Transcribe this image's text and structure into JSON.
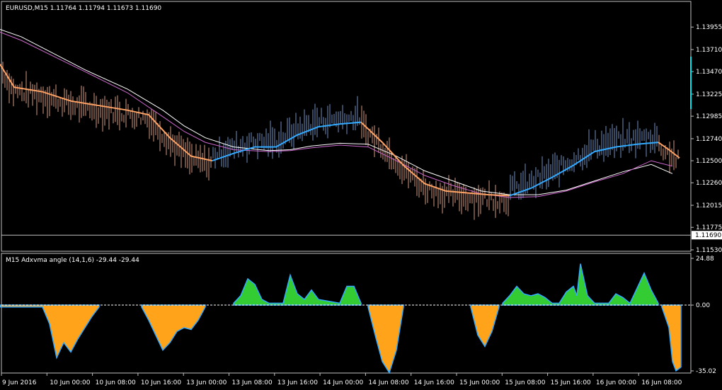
{
  "chart_data": [
    {
      "type": "line",
      "title": "EURUSD,M15  1.11764 1.11794 1.11673 1.11690",
      "ylim": [
        1.1153,
        1.1408
      ],
      "yticks": [
        "1.13955",
        "1.13710",
        "1.13470",
        "1.13225",
        "1.12985",
        "1.12740",
        "1.12500",
        "1.12260",
        "1.12015",
        "1.11775",
        "1.11530"
      ],
      "ytick_values": [
        1.13955,
        1.1371,
        1.1347,
        1.13225,
        1.12985,
        1.1274,
        1.125,
        1.1226,
        1.12015,
        1.11775,
        1.1153
      ],
      "current_price_label": "1.11690",
      "current_price": 1.1169,
      "grid": false,
      "bar_colors": {
        "up": "#6e8fc0",
        "down": "#d49a7e"
      },
      "series": [
        {
          "color": "#ffffff",
          "x": [
            0,
            30,
            80,
            120,
            180,
            230,
            260,
            290,
            330,
            380,
            410,
            440,
            480,
            520,
            560,
            600,
            640,
            680,
            720,
            760,
            800,
            840,
            880,
            920,
            950
          ],
          "y": [
            1.1393,
            1.1385,
            1.1365,
            1.1349,
            1.1328,
            1.1305,
            1.1288,
            1.1275,
            1.1265,
            1.1261,
            1.1262,
            1.1266,
            1.1269,
            1.1268,
            1.1255,
            1.1239,
            1.1228,
            1.1217,
            1.1213,
            1.1213,
            1.1218,
            1.1228,
            1.1238,
            1.1246,
            1.1236
          ]
        },
        {
          "color": "#cc66cc",
          "x": [
            0,
            30,
            80,
            120,
            180,
            230,
            260,
            290,
            330,
            380,
            410,
            440,
            480,
            520,
            560,
            600,
            640,
            680,
            720,
            760,
            800,
            840,
            880,
            920,
            950
          ],
          "y": [
            1.139,
            1.1381,
            1.1362,
            1.1347,
            1.1324,
            1.1298,
            1.1282,
            1.127,
            1.1262,
            1.126,
            1.1261,
            1.1264,
            1.1267,
            1.1265,
            1.125,
            1.1234,
            1.1223,
            1.1214,
            1.121,
            1.1211,
            1.1217,
            1.1227,
            1.1236,
            1.125,
            1.1244
          ]
        },
        {
          "color": "#ffa366",
          "x": [
            0,
            20,
            60,
            100,
            140,
            180,
            210,
            240,
            270,
            300
          ],
          "y": [
            1.1355,
            1.133,
            1.1325,
            1.1315,
            1.131,
            1.1305,
            1.13,
            1.1275,
            1.1255,
            1.125
          ]
        },
        {
          "color": "#33aaff",
          "x": [
            300,
            330,
            360,
            390,
            420,
            450,
            480,
            510
          ],
          "y": [
            1.125,
            1.1258,
            1.1265,
            1.1265,
            1.1278,
            1.1287,
            1.129,
            1.1292
          ]
        },
        {
          "color": "#ffa366",
          "x": [
            510,
            540,
            570,
            600,
            630,
            660,
            690,
            720
          ],
          "y": [
            1.1292,
            1.127,
            1.1245,
            1.1225,
            1.1217,
            1.1215,
            1.1213,
            1.1212
          ]
        },
        {
          "color": "#33aaff",
          "x": [
            720,
            750,
            780,
            810,
            840,
            870,
            900,
            930
          ],
          "y": [
            1.1212,
            1.122,
            1.1232,
            1.1245,
            1.126,
            1.1265,
            1.1268,
            1.127
          ]
        },
        {
          "color": "#ffa366",
          "x": [
            930,
            945,
            960
          ],
          "y": [
            1.127,
            1.1262,
            1.1253
          ]
        }
      ]
    },
    {
      "type": "area",
      "title": "M15 Adxvma angle (14,1,6) -29.44 -29.44",
      "ylim": [
        -35.02,
        24.88
      ],
      "yticks": [
        "24.88",
        "0.00",
        "-35.02"
      ],
      "ytick_values": [
        24.88,
        0,
        -35.02
      ],
      "level_line": 0,
      "series": [
        {
          "color": "#ffa31a",
          "x": [
            0,
            60,
            70,
            80,
            90,
            100,
            110,
            120,
            130,
            140
          ],
          "y": [
            -1,
            -1,
            -10,
            -28,
            -20,
            -25,
            -18,
            -12,
            -6,
            -1
          ]
        },
        {
          "color": "#ffa31a",
          "x": [
            200,
            210,
            220,
            230,
            240,
            250,
            260,
            270,
            280,
            290
          ],
          "y": [
            -1,
            -8,
            -16,
            -24,
            -20,
            -14,
            -12,
            -13,
            -8,
            -1
          ]
        },
        {
          "color": "#33cc33",
          "x": [
            330,
            340,
            350,
            360,
            370,
            380,
            400,
            410,
            420,
            430,
            440,
            450,
            480,
            490,
            500,
            510
          ],
          "y": [
            1,
            5,
            14,
            11,
            3,
            1,
            1,
            16,
            6,
            3,
            8,
            3,
            1,
            10,
            10,
            1
          ]
        },
        {
          "color": "#ffa31a",
          "x": [
            520,
            530,
            540,
            550,
            560,
            570
          ],
          "y": [
            -1,
            -16,
            -30,
            -36,
            -24,
            -1
          ]
        },
        {
          "color": "#ffa31a",
          "x": [
            665,
            675,
            685,
            695,
            705
          ],
          "y": [
            -1,
            -16,
            -22,
            -14,
            -1
          ]
        },
        {
          "color": "#33cc33",
          "x": [
            710,
            720,
            730,
            740,
            750,
            760,
            770,
            780,
            790,
            800,
            810,
            815,
            820,
            830,
            840,
            860,
            870,
            880,
            890,
            910,
            920,
            930
          ],
          "y": [
            1,
            5,
            10,
            6,
            5,
            6,
            4,
            1,
            1,
            7,
            10,
            5,
            22,
            5,
            1,
            1,
            6,
            4,
            1,
            17,
            8,
            1
          ]
        },
        {
          "color": "#ffa31a",
          "x": [
            935,
            945,
            950,
            955,
            962
          ],
          "y": [
            -1,
            -12,
            -30,
            -35,
            -33
          ]
        }
      ]
    }
  ],
  "time_labels": [
    "9 Jun 2016",
    "10 Jun 00:00",
    "10 Jun 08:00",
    "10 Jun 16:00",
    "13 Jun 00:00",
    "13 Jun 08:00",
    "13 Jun 16:00",
    "14 Jun 00:00",
    "14 Jun 08:00",
    "14 Jun 16:00",
    "15 Jun 00:00",
    "15 Jun 08:00",
    "15 Jun 16:00",
    "16 Jun 00:00",
    "16 Jun 08:00"
  ],
  "colors": {
    "background": "#000000",
    "frame": "#c0c0c0",
    "text": "#ffffff",
    "price_line": "#c0c0c0",
    "level_line": "#ffffff",
    "scroll_marker": "#00e5ee"
  }
}
